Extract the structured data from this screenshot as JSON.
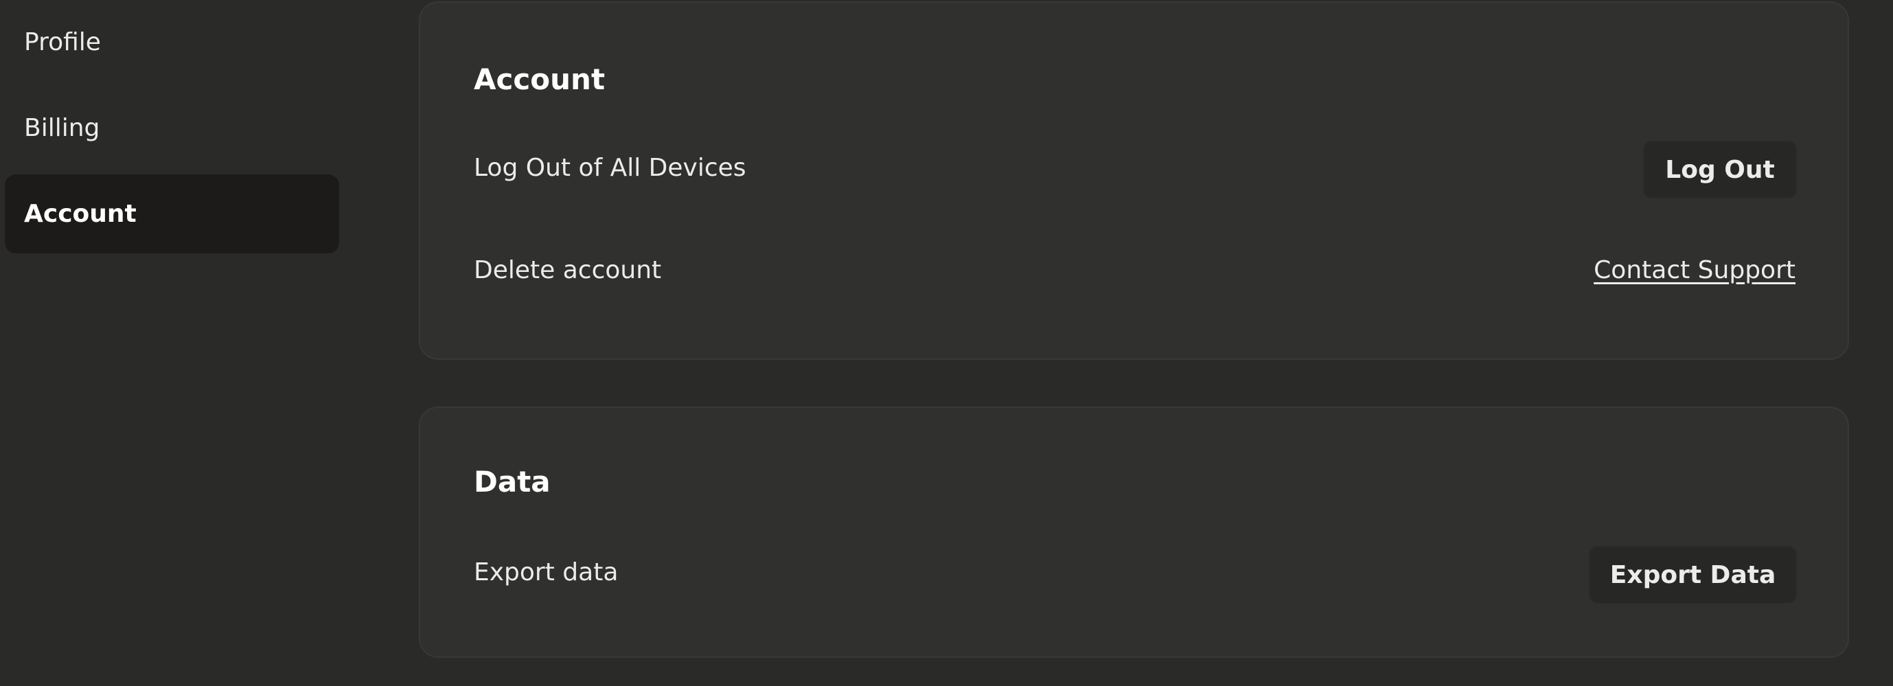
{
  "sidebar": {
    "items": [
      {
        "label": "Profile",
        "active": false
      },
      {
        "label": "Billing",
        "active": false
      },
      {
        "label": "Account",
        "active": true
      }
    ]
  },
  "account_section": {
    "title": "Account",
    "logout_all_label": "Log Out of All Devices",
    "logout_button": "Log Out",
    "delete_label": "Delete account",
    "contact_support_link": "Contact Support"
  },
  "data_section": {
    "title": "Data",
    "export_label": "Export data",
    "export_button": "Export Data"
  },
  "colors": {
    "background": "#2a2a28",
    "card": "#30302e",
    "active_nav": "#1c1b19",
    "button": "#272725",
    "text": "#ececea"
  }
}
